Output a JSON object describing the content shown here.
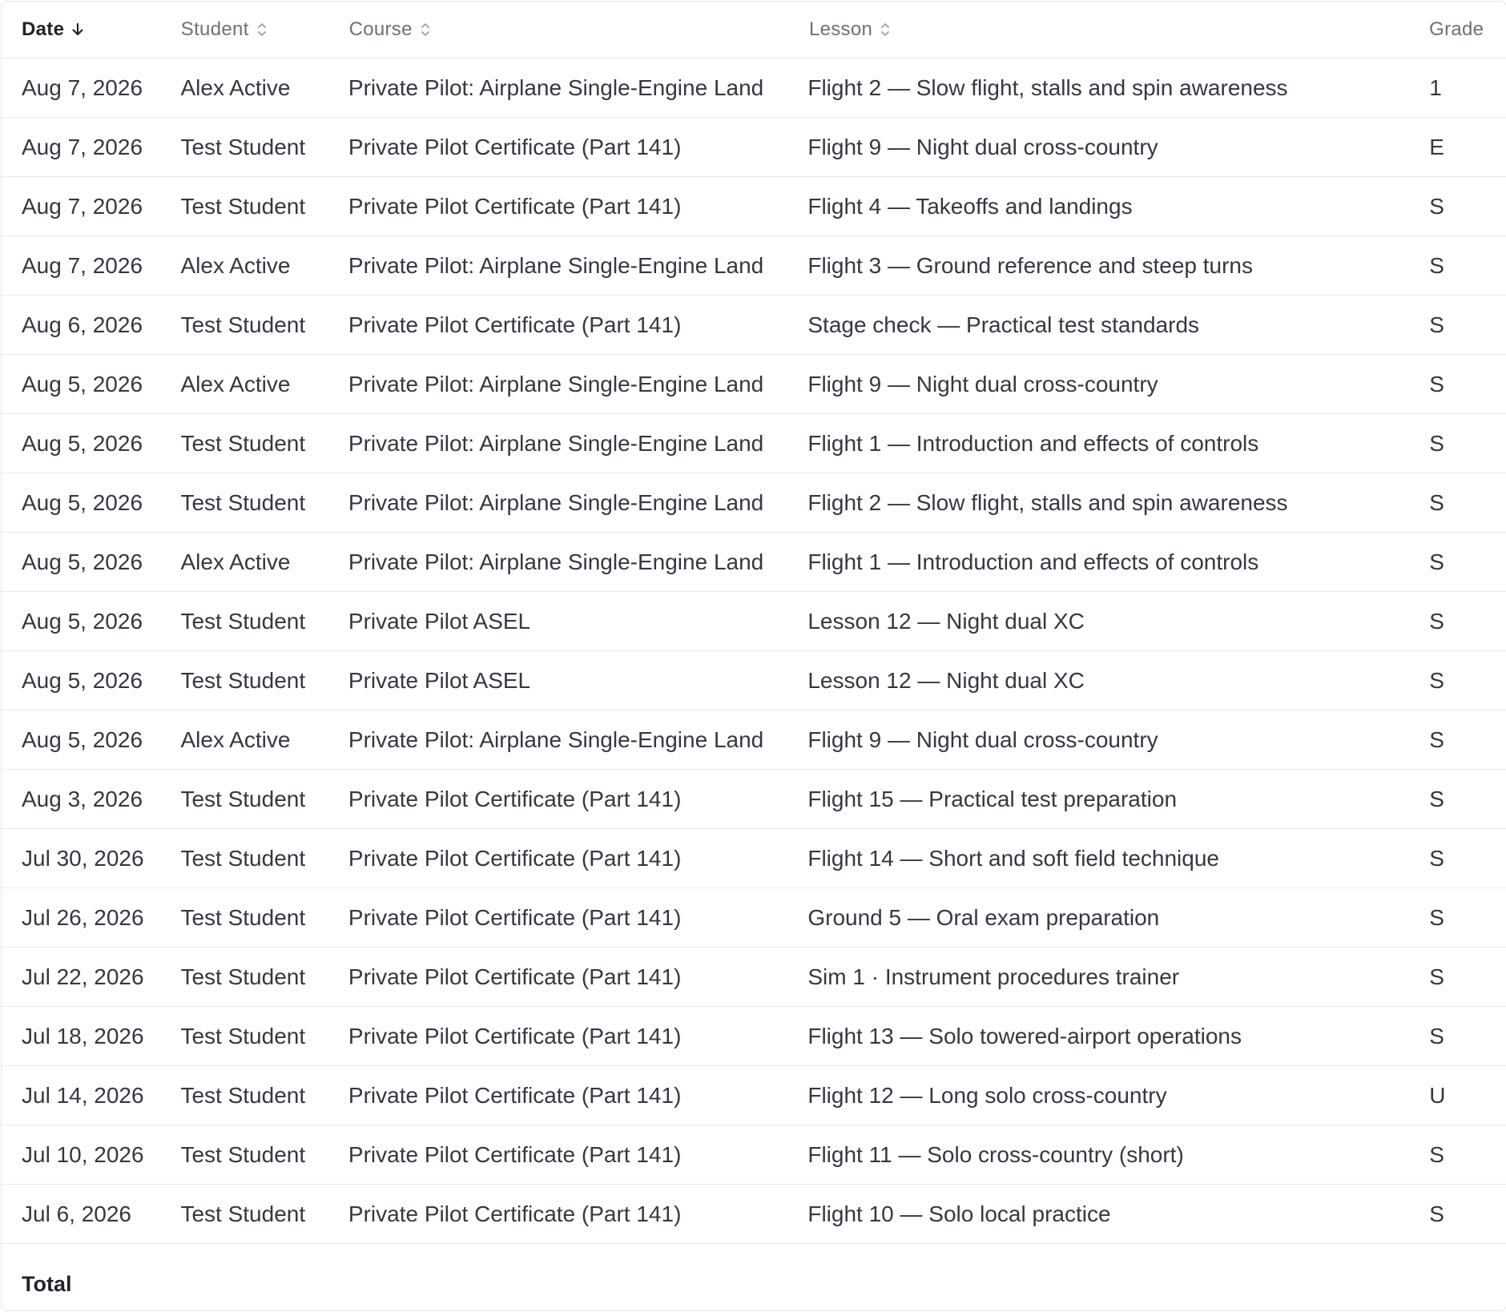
{
  "table": {
    "columns": [
      {
        "key": "date",
        "label": "Date",
        "sort": "desc"
      },
      {
        "key": "student",
        "label": "Student",
        "sort": "none"
      },
      {
        "key": "course",
        "label": "Course",
        "sort": "none"
      },
      {
        "key": "lesson",
        "label": "Lesson",
        "sort": "none"
      },
      {
        "key": "grade",
        "label": "Grade",
        "sort": "none"
      }
    ],
    "rows": [
      {
        "date": "Aug 7, 2026",
        "student": "Alex Active",
        "course": "Private Pilot: Airplane Single-Engine Land",
        "lesson": "Flight 2 — Slow flight, stalls and spin awareness",
        "grade": "1"
      },
      {
        "date": "Aug 7, 2026",
        "student": "Test Student",
        "course": "Private Pilot Certificate (Part 141)",
        "lesson": "Flight 9 — Night dual cross-country",
        "grade": "E"
      },
      {
        "date": "Aug 7, 2026",
        "student": "Test Student",
        "course": "Private Pilot Certificate (Part 141)",
        "lesson": "Flight 4 — Takeoffs and landings",
        "grade": "S"
      },
      {
        "date": "Aug 7, 2026",
        "student": "Alex Active",
        "course": "Private Pilot: Airplane Single-Engine Land",
        "lesson": "Flight 3 — Ground reference and steep turns",
        "grade": "S"
      },
      {
        "date": "Aug 6, 2026",
        "student": "Test Student",
        "course": "Private Pilot Certificate (Part 141)",
        "lesson": "Stage check — Practical test standards",
        "grade": "S"
      },
      {
        "date": "Aug 5, 2026",
        "student": "Alex Active",
        "course": "Private Pilot: Airplane Single-Engine Land",
        "lesson": "Flight 9 — Night dual cross-country",
        "grade": "S"
      },
      {
        "date": "Aug 5, 2026",
        "student": "Test Student",
        "course": "Private Pilot: Airplane Single-Engine Land",
        "lesson": "Flight 1 — Introduction and effects of controls",
        "grade": "S"
      },
      {
        "date": "Aug 5, 2026",
        "student": "Test Student",
        "course": "Private Pilot: Airplane Single-Engine Land",
        "lesson": "Flight 2 — Slow flight, stalls and spin awareness",
        "grade": "S"
      },
      {
        "date": "Aug 5, 2026",
        "student": "Alex Active",
        "course": "Private Pilot: Airplane Single-Engine Land",
        "lesson": "Flight 1 — Introduction and effects of controls",
        "grade": "S"
      },
      {
        "date": "Aug 5, 2026",
        "student": "Test Student",
        "course": "Private Pilot ASEL",
        "lesson": "Lesson 12 — Night dual XC",
        "grade": "S"
      },
      {
        "date": "Aug 5, 2026",
        "student": "Test Student",
        "course": "Private Pilot ASEL",
        "lesson": "Lesson 12 — Night dual XC",
        "grade": "S"
      },
      {
        "date": "Aug 5, 2026",
        "student": "Alex Active",
        "course": "Private Pilot: Airplane Single-Engine Land",
        "lesson": "Flight 9 — Night dual cross-country",
        "grade": "S"
      },
      {
        "date": "Aug 3, 2026",
        "student": "Test Student",
        "course": "Private Pilot Certificate (Part 141)",
        "lesson": "Flight 15 — Practical test preparation",
        "grade": "S"
      },
      {
        "date": "Jul 30, 2026",
        "student": "Test Student",
        "course": "Private Pilot Certificate (Part 141)",
        "lesson": "Flight 14 — Short and soft field technique",
        "grade": "S"
      },
      {
        "date": "Jul 26, 2026",
        "student": "Test Student",
        "course": "Private Pilot Certificate (Part 141)",
        "lesson": "Ground 5 — Oral exam preparation",
        "grade": "S"
      },
      {
        "date": "Jul 22, 2026",
        "student": "Test Student",
        "course": "Private Pilot Certificate (Part 141)",
        "lesson": "Sim 1 · Instrument procedures trainer",
        "grade": "S"
      },
      {
        "date": "Jul 18, 2026",
        "student": "Test Student",
        "course": "Private Pilot Certificate (Part 141)",
        "lesson": "Flight 13 — Solo towered-airport operations",
        "grade": "S"
      },
      {
        "date": "Jul 14, 2026",
        "student": "Test Student",
        "course": "Private Pilot Certificate (Part 141)",
        "lesson": "Flight 12 — Long solo cross-country",
        "grade": "U"
      },
      {
        "date": "Jul 10, 2026",
        "student": "Test Student",
        "course": "Private Pilot Certificate (Part 141)",
        "lesson": "Flight 11 — Solo cross-country (short)",
        "grade": "S"
      },
      {
        "date": "Jul 6, 2026",
        "student": "Test Student",
        "course": "Private Pilot Certificate (Part 141)",
        "lesson": "Flight 10 — Solo local practice",
        "grade": "S"
      }
    ],
    "footer": {
      "total_label": "Total"
    }
  },
  "icons": {
    "sort_active": "arrow-down-icon",
    "sort_inactive": "chevron-up-down-icon"
  },
  "colors": {
    "border": "#e3e5e8",
    "text": "#333842",
    "header_text": "#6b717b"
  }
}
